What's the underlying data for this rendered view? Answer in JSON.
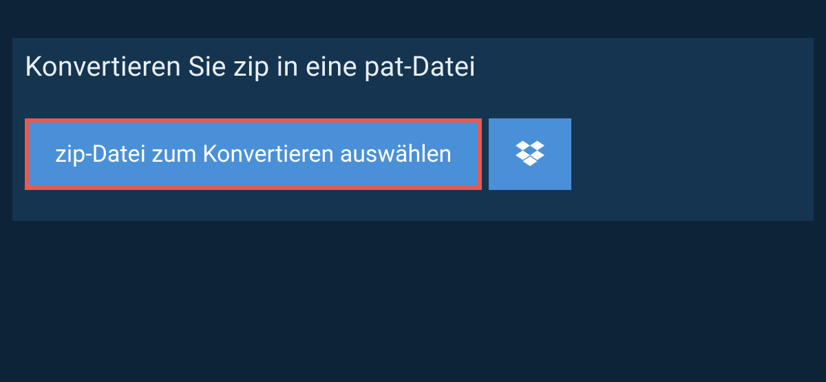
{
  "heading": "Konvertieren Sie zip in eine pat-Datei",
  "buttons": {
    "select_file_label": "zip-Datei zum Konvertieren auswählen"
  },
  "colors": {
    "page_bg": "#0d2438",
    "panel_bg": "#153450",
    "button_bg": "#4a90d9",
    "highlight_border": "#e85a4f",
    "text_light": "#e8eef3",
    "text_white": "#ffffff"
  }
}
